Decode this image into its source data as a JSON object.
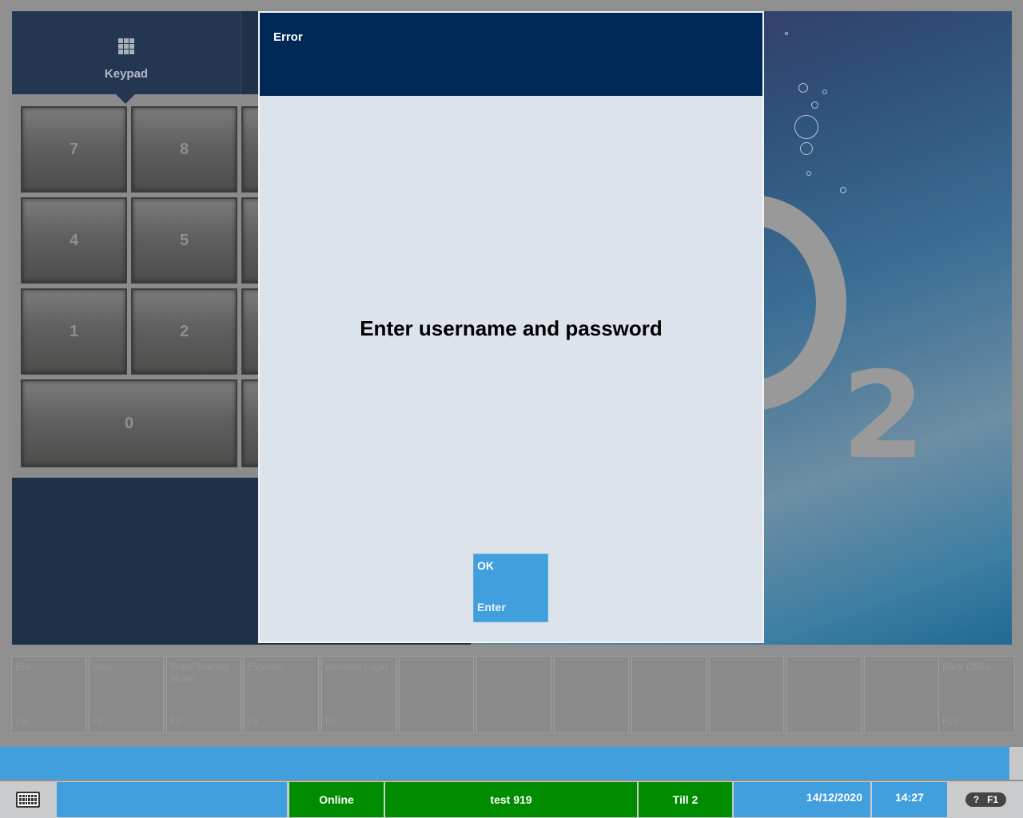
{
  "keypad": {
    "tab_label": "Keypad",
    "icon": "keypad-grid-icon",
    "keys": [
      "7",
      "8",
      "4",
      "5",
      "1",
      "2",
      "0"
    ]
  },
  "dialog": {
    "title": "Error",
    "message": "Enter username and password",
    "ok_label": "OK",
    "ok_hotkey": "Enter"
  },
  "function_keys": [
    {
      "label": "Exit",
      "code": "Esc"
    },
    {
      "label": "Help",
      "code": "F1"
    },
    {
      "label": "Enter Training Mode",
      "code": "F2"
    },
    {
      "label": "Explorer",
      "code": "F3"
    },
    {
      "label": "Assisted Login",
      "code": "F4"
    },
    {
      "label": "",
      "code": ""
    },
    {
      "label": "",
      "code": ""
    },
    {
      "label": "",
      "code": ""
    },
    {
      "label": "",
      "code": ""
    },
    {
      "label": "",
      "code": ""
    },
    {
      "label": "",
      "code": ""
    },
    {
      "label": "",
      "code": ""
    },
    {
      "label": "Back Office",
      "code": "F12"
    }
  ],
  "status_bar": {
    "keyboard_icon": "keyboard-icon",
    "connection": "Online",
    "user": "test 919",
    "till": "Till 2",
    "date": "14/12/2020",
    "time": "14:27",
    "help_q": "?",
    "help_key": "F1"
  },
  "colors": {
    "dialog_header": "#002856",
    "accent_blue": "#419fdd",
    "status_green": "#008c00"
  }
}
